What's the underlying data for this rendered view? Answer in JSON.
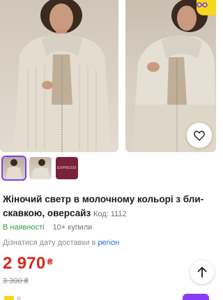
{
  "gallery": {
    "photos": [
      "product-photo-1",
      "product-photo-2"
    ],
    "badge_icon": "glasses-icon",
    "favorite_icon": "heart-outline-icon"
  },
  "thumbnails": {
    "items": [
      "thumbnail-1",
      "thumbnail-2",
      "thumbnail-3"
    ],
    "brand_text": "EXPRESSI",
    "active_index": 0
  },
  "product": {
    "title": "Жіночий светр в молочному кольорі з бли-скавкою, оверсайз",
    "code_label": "Код: 1112",
    "in_stock": "В наявності",
    "bought": "10+ купили",
    "delivery_text": "Дізнатися дату доставки в",
    "delivery_region": "регіон",
    "price": "2 970",
    "currency": "₴",
    "old_price": "3 300 ₴"
  },
  "actions": {
    "scroll_top_icon": "arrow-up-icon"
  },
  "colors": {
    "accent_purple": "#7b3ff2",
    "price_red": "#d9261c",
    "stock_green": "#2e9d3b",
    "link_blue": "#1f6fd6",
    "badge_yellow": "#f4d81b"
  }
}
